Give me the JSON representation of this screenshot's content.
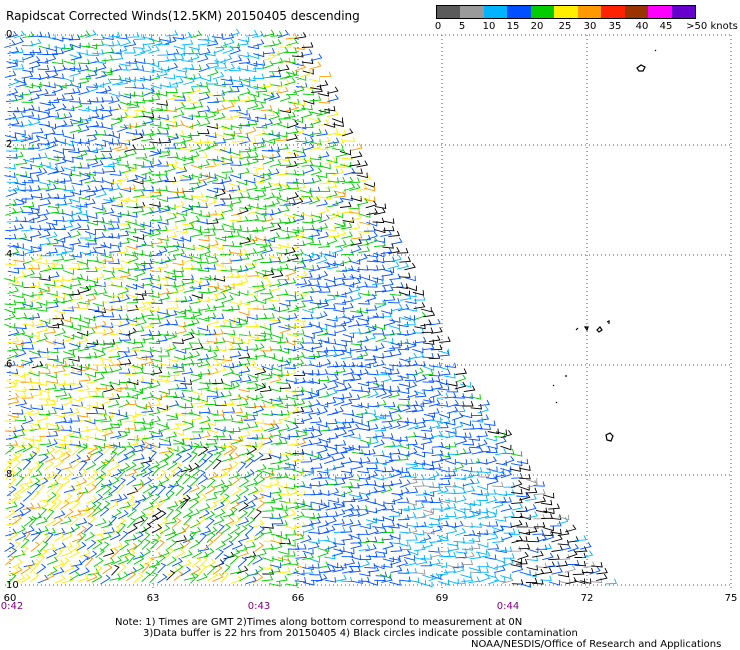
{
  "title": "Rapidscat Corrected Winds(12.5KM) 20150405 descending",
  "color_scale": {
    "labels": [
      "0",
      "5",
      "10",
      "15",
      "20",
      "25",
      "30",
      "35",
      "40",
      "45",
      ">50 knots"
    ],
    "colors": [
      "#5a5a5a",
      "#9a9a9a",
      "#00b4ff",
      "#0050ff",
      "#00cc00",
      "#ffee00",
      "#ff9900",
      "#ff2200",
      "#993300",
      "#ff00ff",
      "#6600cc"
    ]
  },
  "latitude_ticks": [
    "0",
    "2",
    "4",
    "6",
    "8",
    "10"
  ],
  "longitude_ticks": [
    "60",
    "63",
    "66",
    "69",
    "72",
    "75"
  ],
  "time_ticks": [
    "0:42",
    "0:43",
    "0:44"
  ],
  "notes": {
    "line1": "Note: 1) Times are GMT 2)Times along bottom correspond to measurement at 0N",
    "line2": "3)Data buffer is 22 hrs from 20150405 4) Black circles indicate possible contamination",
    "line3": "NOAA/NESDIS/Office of Research and Applications"
  }
}
